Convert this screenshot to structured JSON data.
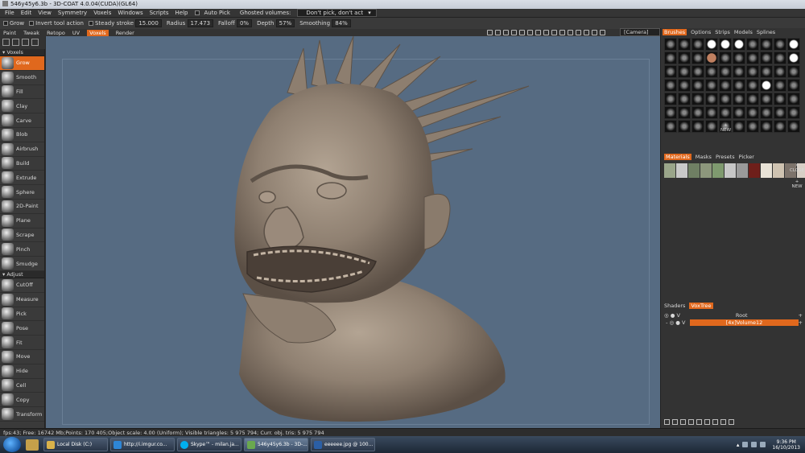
{
  "window": {
    "title": "546y45y6.3b - 3D-COAT 4.0.04(CUDA)(GL64)"
  },
  "menu": [
    "File",
    "Edit",
    "View",
    "Symmetry",
    "Voxels",
    "Windows",
    "Scripts",
    "Help"
  ],
  "menu_extras": {
    "auto_pick": "Auto Pick",
    "ghosted_label": "Ghosted volumes:",
    "ghosted_value": "Don't pick, don't act"
  },
  "toolbar": {
    "tool": "Grow",
    "invert": "Invert tool action",
    "steady": "Steady stroke",
    "steady_val": "15.000",
    "radius": "Radius",
    "radius_val": "17.473",
    "falloff": "Falloff",
    "falloff_val": "0%",
    "depth": "Depth",
    "depth_val": "57%",
    "smoothing": "Smoothing",
    "smoothing_val": "84%"
  },
  "room_tabs": [
    "Paint",
    "Tweak",
    "Retopo",
    "UV",
    "Voxels",
    "Render"
  ],
  "active_room": "Voxels",
  "camera": "[Camera]",
  "tools": {
    "section_voxels": "Voxels",
    "section_adjust": "Adjust",
    "voxels": [
      "Grow",
      "Smooth",
      "Fill",
      "Clay",
      "Carve",
      "Blob",
      "Airbrush",
      "Build",
      "Extrude",
      "Sphere",
      "2D-Paint",
      "Plane",
      "Scrape",
      "Pinch",
      "Smudge"
    ],
    "adjust": [
      "CutOff",
      "Measure",
      "Pick",
      "Pose",
      "Fit",
      "Move",
      "Hide",
      "Cell",
      "Copy",
      "Transform"
    ]
  },
  "right": {
    "brush_tabs": [
      "Brushes",
      "Options",
      "Strips",
      "Models",
      "Splines"
    ],
    "brush_new": "NEW",
    "mat_tabs": [
      "Materials",
      "Masks",
      "Presets",
      "Picker"
    ],
    "mat_close": "CLOSE",
    "mat_new": "NEW",
    "mat_colors": [
      "#9aa58a",
      "#c9c9c9",
      "#6f7f63",
      "#8d977c",
      "#7f9a6f",
      "#c7c7c7",
      "#9a9a9a",
      "#6e1f1a",
      "#e8e2d6",
      "#cfc3b1",
      "#7d736b",
      "#d8cfc6",
      "#b5a189",
      "#8a8a88"
    ],
    "vox_tabs": [
      "Shaders",
      "VoxTree"
    ],
    "voxtree": [
      {
        "name": "Root"
      },
      {
        "name": "[4x]Volume12"
      }
    ]
  },
  "status": "fps:43;    Free: 16742 Mb;Points: 170 405;Object scale: 4.00 (Uniform); Visible triangles: 5 975 794; Curr. obj. tris: 5 975 794",
  "taskbar": {
    "items": [
      {
        "label": "Local Disk (C:)",
        "color": "#d9b24a"
      },
      {
        "label": "http://i.imgur.co...",
        "color": "#2e86d6"
      },
      {
        "label": "Skype™ - milan.ja...",
        "color": "#00aff0"
      },
      {
        "label": "546y45y6.3b - 3D-...",
        "color": "#6aa84f"
      },
      {
        "label": "eeeeee.jpg @ 100...",
        "color": "#2b5fa5"
      }
    ],
    "time": "9:36 PM",
    "date": "16/10/2013"
  },
  "colors": {
    "accent": "#e0681d",
    "viewport_bg": "#566b82",
    "sculpt": "#8a7b6c"
  }
}
